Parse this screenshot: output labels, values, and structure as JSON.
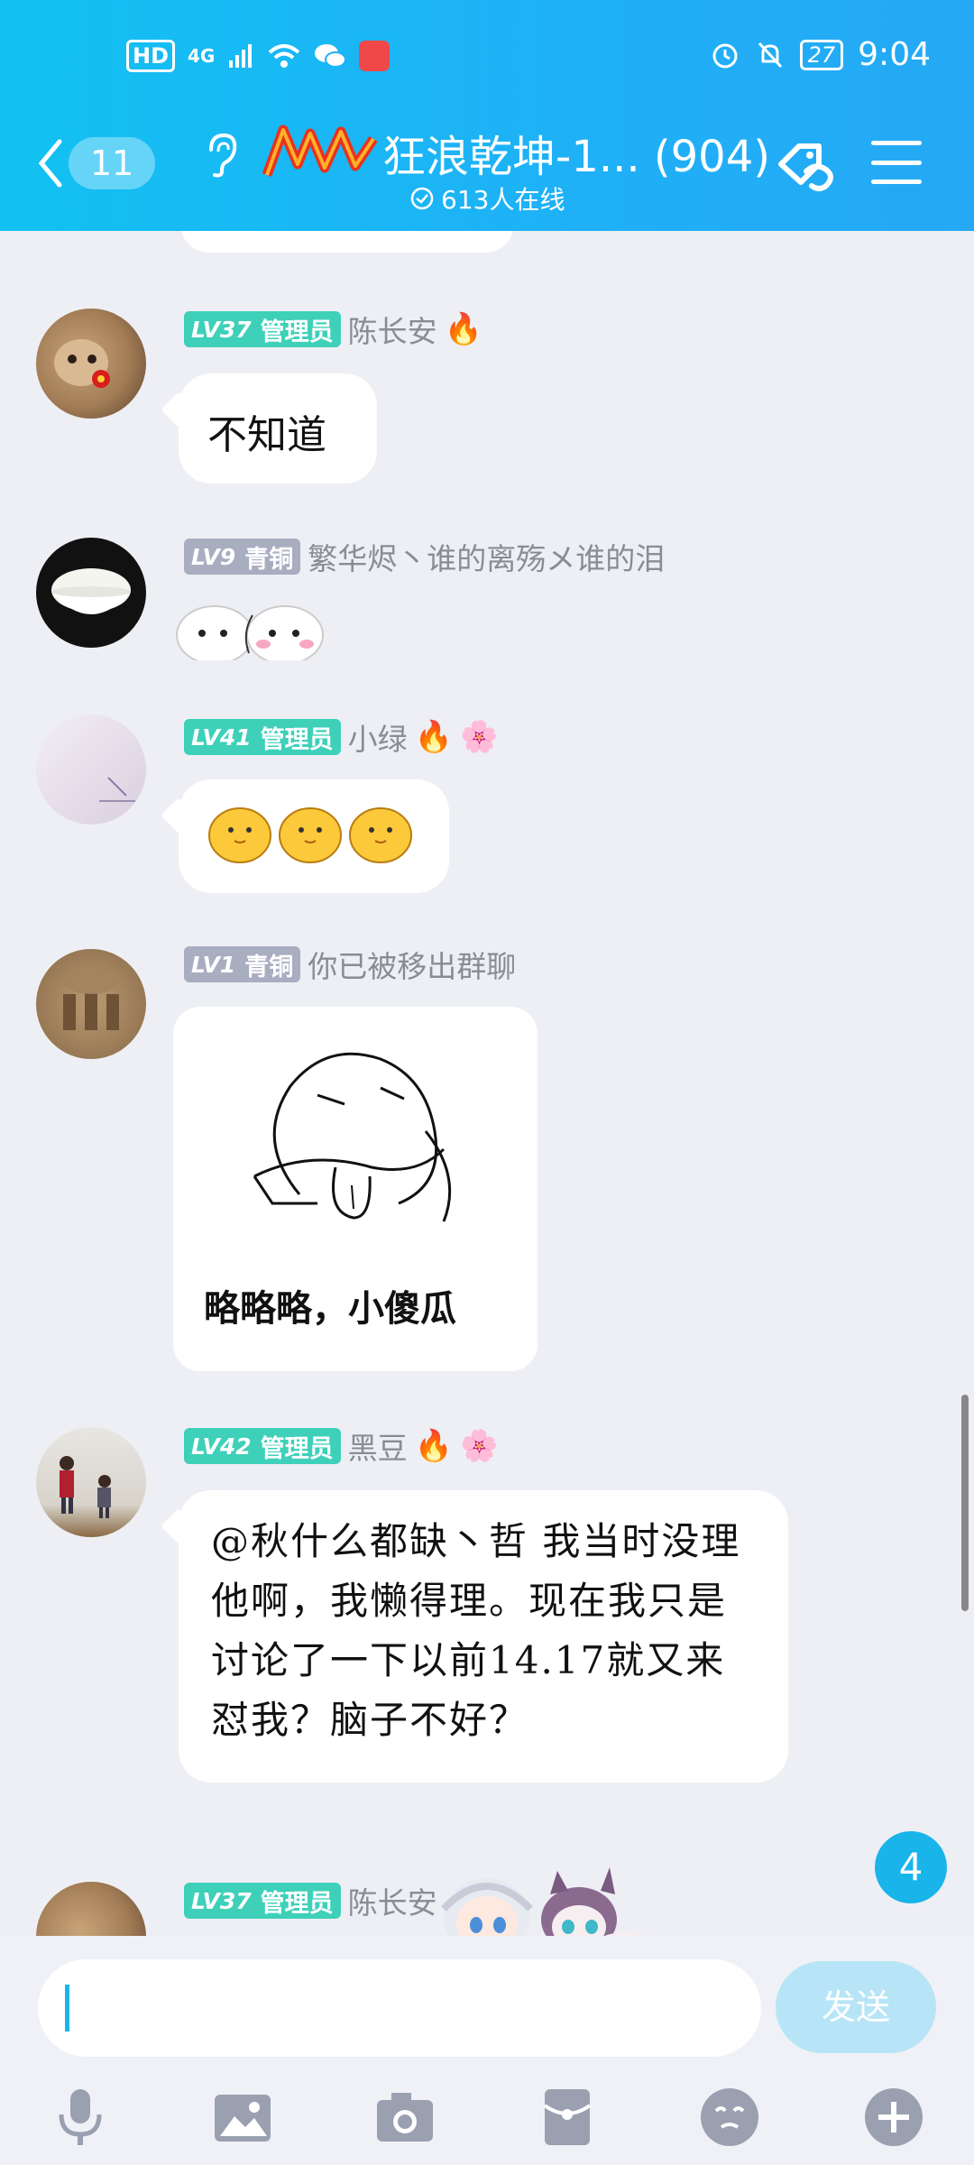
{
  "status_bar": {
    "hd": "HD",
    "network": "4G",
    "battery": "27",
    "time": "9:04"
  },
  "header": {
    "back_count": "11",
    "group_title": "狂浪乾坤-1... (904)",
    "online": "613人在线"
  },
  "messages": [
    {
      "level": "LV37",
      "role": "管理员",
      "nick": "陈长安",
      "text": "不知道"
    },
    {
      "level": "LV9",
      "role": "青铜",
      "nick": "繁华烬丶谁的离殇メ谁的泪"
    },
    {
      "level": "LV41",
      "role": "管理员",
      "nick": "小绿"
    },
    {
      "level": "LV1",
      "role": "青铜",
      "nick": "你已被移出群聊",
      "sticker_caption": "略略略，小傻瓜"
    },
    {
      "level": "LV42",
      "role": "管理员",
      "nick": "黑豆",
      "text": "@秋什么都缺丶哲 我当时没理他啊，我懒得理。现在我只是讨论了一下以前14.17就又来怼我？脑子不好？"
    },
    {
      "level": "LV37",
      "role": "管理员",
      "nick": "陈长安"
    }
  ],
  "unread_count": "4",
  "input": {
    "send_label": "发送"
  },
  "toolbar": [
    "mic-icon",
    "image-icon",
    "camera-icon",
    "red-packet-icon",
    "emoji-icon",
    "plus-icon"
  ],
  "colors": {
    "header": "#1fb0f6",
    "admin_badge": "#3ed0b9",
    "bronze_badge": "#a8adc0",
    "send_disabled": "#b7e5f7"
  }
}
